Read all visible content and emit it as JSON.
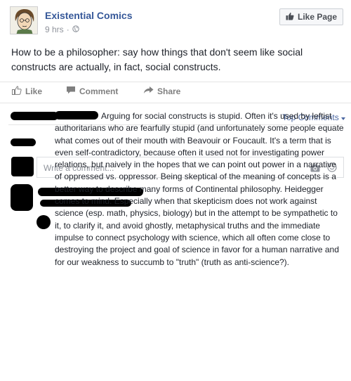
{
  "post": {
    "page_name": "Existential Comics",
    "time": "9 hrs",
    "text": "How to be a philosopher: say how things that don't seem like social constructs are actually, in fact, social constructs."
  },
  "header": {
    "like_page_label": "Like Page"
  },
  "actions": {
    "like": "Like",
    "comment": "Comment",
    "share": "Share"
  },
  "comments": {
    "sort_label": "Top Comments",
    "input_placeholder": "Write a comment...",
    "reply_text": "Arguing for social constructs is stupid. Often it's used by leftist authoritarians who are fearfully stupid (and unfortunately some people equate what comes out of their mouth with Beavouir or Foucault. It's a term that is even self-contradictory, because often it used not for investigating power relations, but naively in the hopes that we can point out power in a narrative of oppressed vs. oppressor. Being skeptical of the meaning of concepts is a better way to describe many forms of Continental philosophy. Heidegger comes to mind. Especially when that skepticism does not work against science (esp. math, physics, biology) but in the attempt to be sympathetic to it, to clarify it, and avoid ghostly, metaphysical truths and the immediate impulse to connect psychology with science, which all often come close to destroying the project and goal of science in favor for a human narrative and for our weakness to succumb to \"truth\" (truth as anti-science?)."
  },
  "icons": {
    "globe": "globe-icon",
    "thumb": "thumbs-up-icon",
    "comment": "comment-bubble-icon",
    "share": "share-arrow-icon",
    "camera": "camera-icon",
    "emoji": "smiley-icon"
  },
  "colors": {
    "link": "#365899",
    "muted": "#90949c",
    "action_gray": "#7f7f7f",
    "redaction": "#000000"
  }
}
